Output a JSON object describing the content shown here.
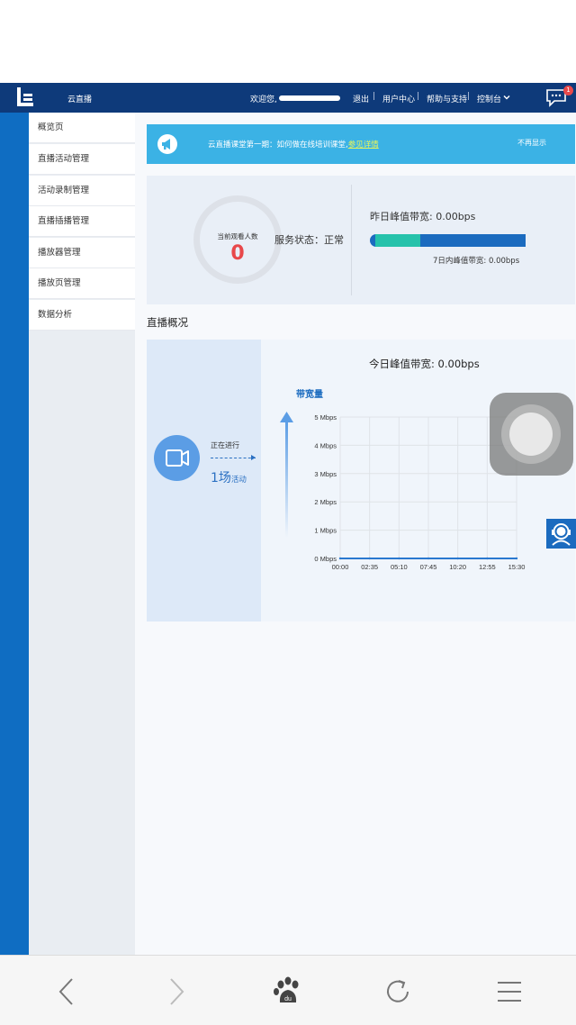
{
  "header": {
    "brand": "云直播",
    "welcome": "欢迎您,",
    "logout": "退出",
    "user_center": "用户中心",
    "help": "帮助与支持",
    "console": "控制台",
    "chat_badge": "1",
    "separator": "|"
  },
  "sidebar": {
    "items": [
      {
        "label": "概览页"
      },
      {
        "label": "直播活动管理"
      },
      {
        "label": "活动录制管理"
      },
      {
        "label": "直播插播管理"
      },
      {
        "label": "播放器管理"
      },
      {
        "label": "播放页管理"
      },
      {
        "label": "数据分析"
      }
    ]
  },
  "notice": {
    "text": "云直播课堂第一期：如何做在线培训课堂,",
    "link": "参见详情",
    "close": "不再显示"
  },
  "stats": {
    "viewers_label": "当前观看人数",
    "viewers_value": "0",
    "service_status": "服务状态：正常",
    "yesterday_peak": "昨日峰值带宽:  0.00bps",
    "seven_day_peak": "7日内峰值带宽:  0.00bps",
    "yesterday_bar_fraction": 0.3
  },
  "section": {
    "title": "直播概况"
  },
  "live": {
    "ongoing": "正在进行",
    "count": "1场",
    "count_unit": "活动",
    "today_peak": "今日峰值带宽:  0.00bps",
    "bandwidth_label": "带宽量"
  },
  "chart_data": {
    "type": "line",
    "x": [
      "00:00",
      "02:35",
      "05:10",
      "07:45",
      "10:20",
      "12:55",
      "15:30"
    ],
    "series": [
      {
        "values": [
          0,
          0,
          0,
          0,
          0,
          0,
          0
        ]
      }
    ],
    "y_ticks": [
      "0 Mbps",
      "1 Mbps",
      "2 Mbps",
      "3 Mbps",
      "4 Mbps",
      "5 Mbps"
    ],
    "ylim": [
      0,
      5
    ],
    "grid": true,
    "colors": {
      "line": "#2a78d0",
      "grid": "#dfe3e8"
    }
  },
  "colors": {
    "header": "#0e3a7a",
    "accent": "#0f6dc2",
    "notice": "#3bb2e5",
    "danger": "#e8484a",
    "teal": "#26c2ab"
  }
}
